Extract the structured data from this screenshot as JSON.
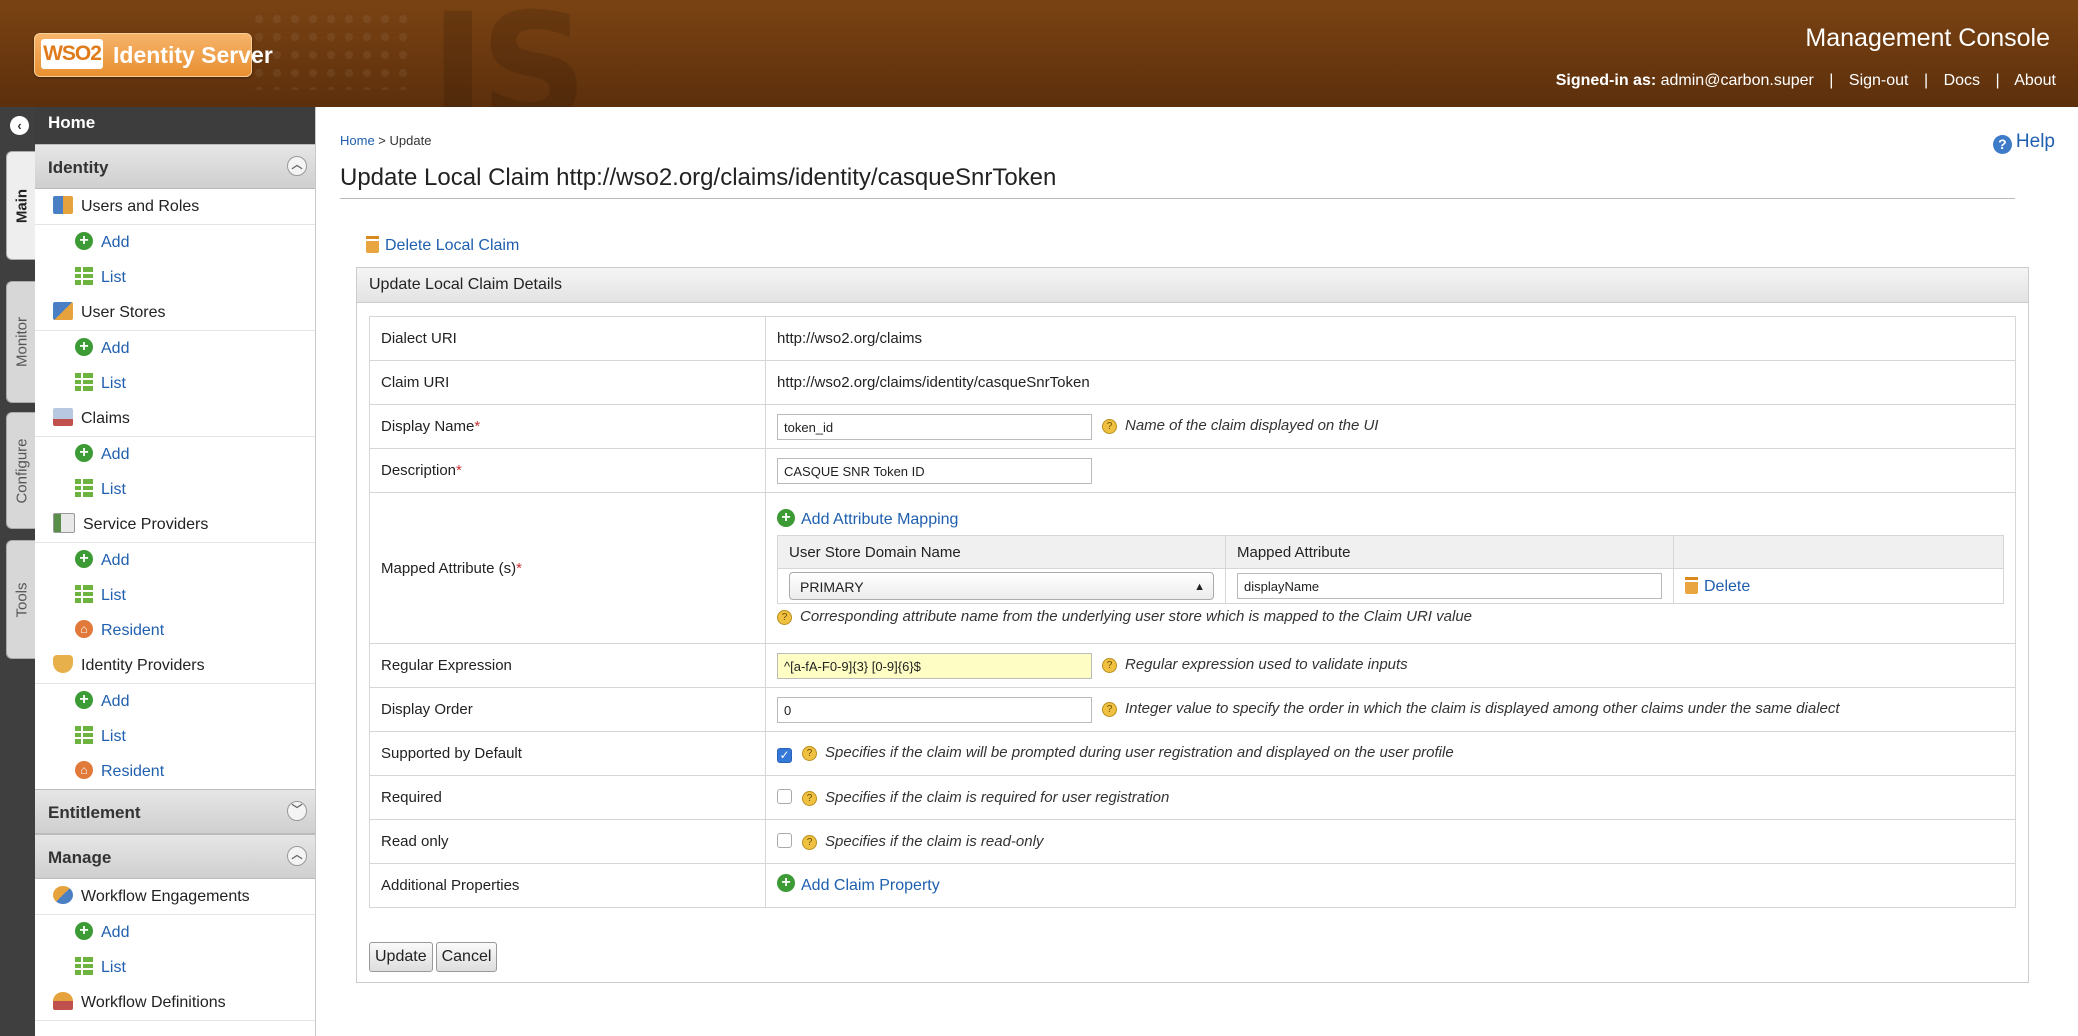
{
  "header": {
    "logo_wso": "WSO2",
    "logo_product": "Identity Server",
    "console_title": "Management Console",
    "signed_in_label": "Signed-in as:",
    "signed_in_user": "admin@carbon.super",
    "links": [
      "Sign-out",
      "Docs",
      "About"
    ]
  },
  "vtabs": [
    "Main",
    "Monitor",
    "Configure",
    "Tools"
  ],
  "sidebar": {
    "home": "Home",
    "sections": {
      "identity": "Identity",
      "entitlement": "Entitlement",
      "manage": "Manage"
    },
    "users_roles": {
      "label": "Users and Roles",
      "add": "Add",
      "list": "List"
    },
    "user_stores": {
      "label": "User Stores",
      "add": "Add",
      "list": "List"
    },
    "claims": {
      "label": "Claims",
      "add": "Add",
      "list": "List"
    },
    "service_providers": {
      "label": "Service Providers",
      "add": "Add",
      "list": "List",
      "resident": "Resident"
    },
    "identity_providers": {
      "label": "Identity Providers",
      "add": "Add",
      "list": "List",
      "resident": "Resident"
    },
    "workflow_engagements": {
      "label": "Workflow Engagements",
      "add": "Add",
      "list": "List"
    },
    "workflow_definitions": {
      "label": "Workflow Definitions"
    }
  },
  "main": {
    "breadcrumb_home": "Home",
    "breadcrumb_sep": " > ",
    "breadcrumb_current": "Update",
    "help": "Help",
    "title": "Update Local Claim http://wso2.org/claims/identity/casqueSnrToken",
    "delete_link": "Delete Local Claim",
    "panel_title": "Update Local Claim Details",
    "fields": {
      "dialect_uri": {
        "label": "Dialect URI",
        "value": "http://wso2.org/claims"
      },
      "claim_uri": {
        "label": "Claim URI",
        "value": "http://wso2.org/claims/identity/casqueSnrToken"
      },
      "display_name": {
        "label": "Display Name",
        "required": "*",
        "value": "token_id",
        "hint": "Name of the claim displayed on the UI"
      },
      "description": {
        "label": "Description",
        "required": "*",
        "value": "CASQUE SNR Token ID"
      },
      "mapped_attributes": {
        "label": "Mapped Attribute (s)",
        "required": "*",
        "add_link": "Add Attribute Mapping",
        "col_domain": "User Store Domain Name",
        "col_attribute": "Mapped Attribute",
        "row": {
          "domain": "PRIMARY",
          "attribute": "displayName",
          "delete": "Delete"
        },
        "hint": "Corresponding attribute name from the underlying user store which is mapped to the Claim URI value"
      },
      "regex": {
        "label": "Regular Expression",
        "value": "^[a-fA-F0-9]{3} [0-9]{6}$",
        "hint": "Regular expression used to validate inputs"
      },
      "display_order": {
        "label": "Display Order",
        "value": "0",
        "hint": "Integer value to specify the order in which the claim is displayed among other claims under the same dialect"
      },
      "supported_default": {
        "label": "Supported by Default",
        "checked": true,
        "hint": "Specifies if the claim will be prompted during user registration and displayed on the user profile"
      },
      "required": {
        "label": "Required",
        "checked": false,
        "hint": "Specifies if the claim is required for user registration"
      },
      "read_only": {
        "label": "Read only",
        "checked": false,
        "hint": "Specifies if the claim is read-only"
      },
      "additional": {
        "label": "Additional Properties",
        "add_link": "Add Claim Property"
      }
    },
    "buttons": {
      "update": "Update",
      "cancel": "Cancel"
    }
  },
  "colors": {
    "header_brown": "#6a380f",
    "link_blue": "#1f5fb0",
    "add_green": "#3d9b35",
    "regex_bg": "#fefec4"
  },
  "icons": [
    "help-icon",
    "trash-icon",
    "add-icon",
    "list-icon",
    "resident-icon",
    "collapse-icon",
    "chevron-icon",
    "question-icon",
    "checkbox-icon"
  ]
}
